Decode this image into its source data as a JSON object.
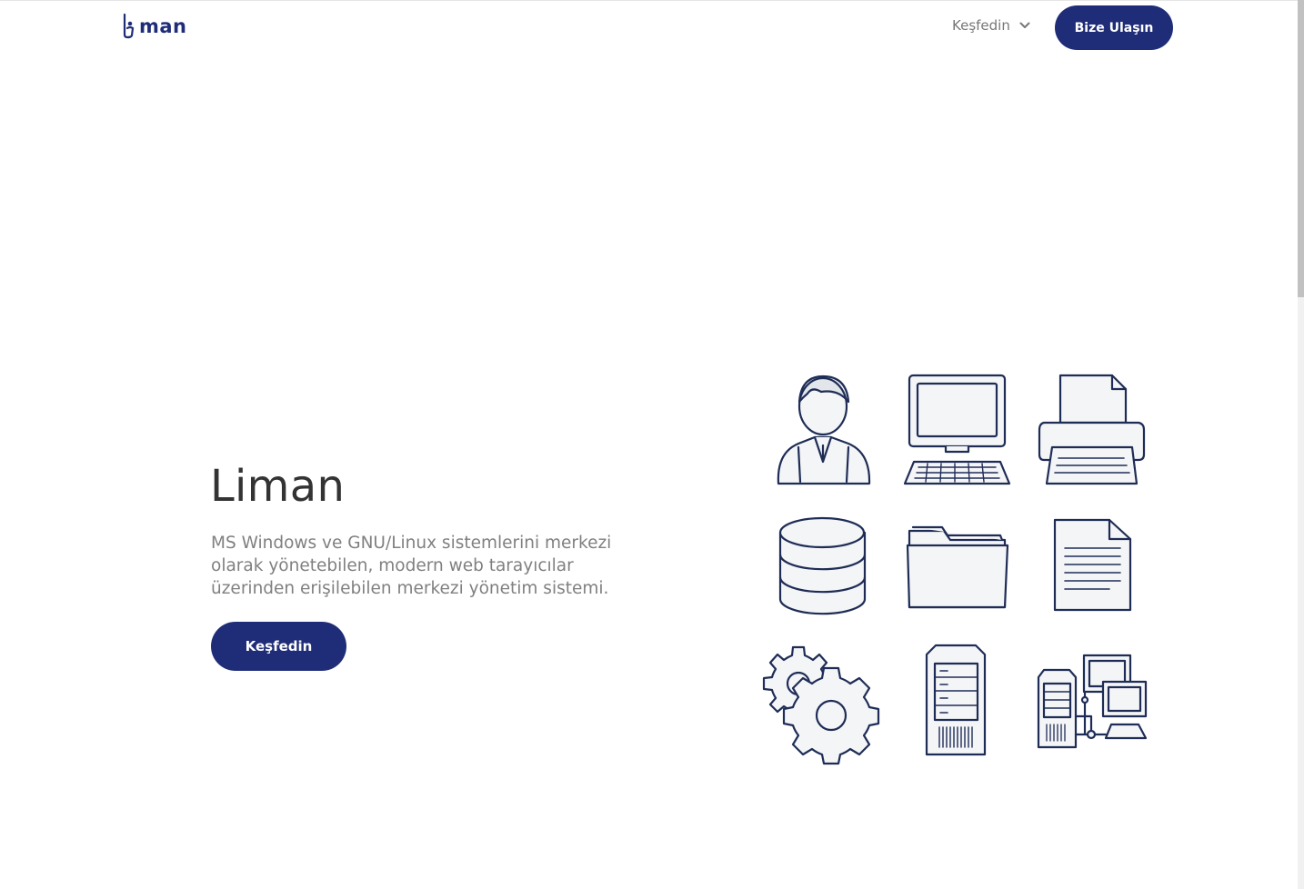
{
  "header": {
    "logo_text": "man",
    "nav_explore_label": "Keşfedin",
    "contact_button_label": "Bize Ulaşın"
  },
  "hero": {
    "title": "Liman",
    "description": "MS Windows ve GNU/Linux sistemlerini merkezi olarak yönetebilen, modern web tarayıcılar üzerinden erişilebilen merkezi yönetim sistemi.",
    "cta_label": "Keşfedin"
  },
  "illustration": {
    "icons": [
      "user-icon",
      "computer-icon",
      "printer-icon",
      "database-icon",
      "folder-icon",
      "document-icon",
      "gears-icon",
      "server-tower-icon",
      "network-icon"
    ],
    "stroke_color": "#1f2d56",
    "fill_color": "#f4f5f7"
  },
  "colors": {
    "brand": "#1f2d78",
    "text_dark": "#333333",
    "text_muted": "#808080"
  }
}
